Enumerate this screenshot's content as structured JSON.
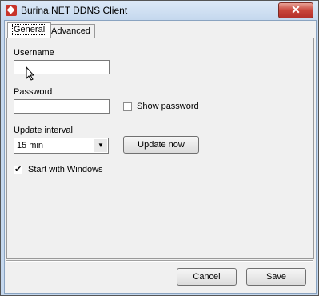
{
  "window": {
    "title": "Burina.NET DDNS Client",
    "close_label": "✕"
  },
  "tabs": [
    {
      "label": "General"
    },
    {
      "label": "Advanced"
    }
  ],
  "general": {
    "username_label": "Username",
    "username_value": "",
    "password_label": "Password",
    "password_value": "",
    "show_password_label": "Show password",
    "show_password_checked": false,
    "update_interval_label": "Update interval",
    "update_interval_value": "15 min",
    "update_now_label": "Update now",
    "start_with_windows_label": "Start with Windows",
    "start_with_windows_checked": true
  },
  "footer": {
    "cancel_label": "Cancel",
    "save_label": "Save"
  }
}
